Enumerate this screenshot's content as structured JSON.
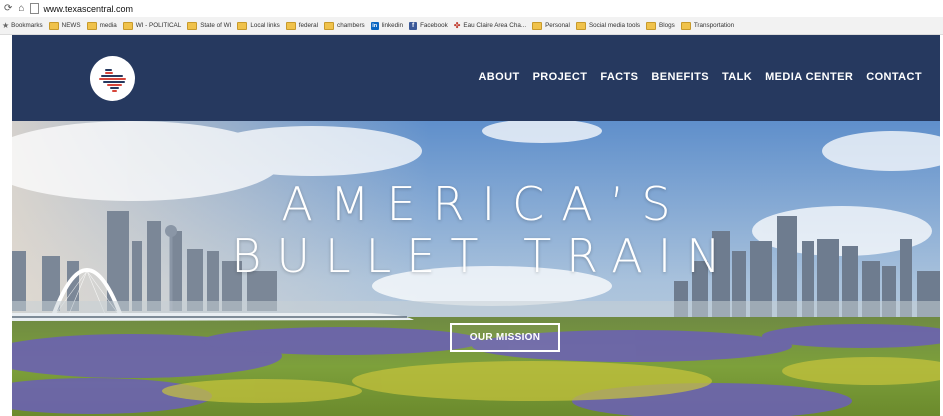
{
  "browser": {
    "url": "www.texascentral.com",
    "bookmarks": [
      {
        "label": "Bookmarks",
        "icon": "star-icon"
      },
      {
        "label": "NEWS",
        "icon": "folder-icon"
      },
      {
        "label": "media",
        "icon": "folder-icon"
      },
      {
        "label": "WI - POLITICAL",
        "icon": "folder-icon"
      },
      {
        "label": "State of WI",
        "icon": "folder-icon"
      },
      {
        "label": "Local links",
        "icon": "folder-icon"
      },
      {
        "label": "federal",
        "icon": "folder-icon"
      },
      {
        "label": "chambers",
        "icon": "folder-icon"
      },
      {
        "label": "linkedin",
        "icon": "linkedin-icon"
      },
      {
        "label": "Facebook",
        "icon": "facebook-icon"
      },
      {
        "label": "Eau Claire Area Cha...",
        "icon": "chamber-icon"
      },
      {
        "label": "Personal",
        "icon": "folder-icon"
      },
      {
        "label": "Social media tools",
        "icon": "folder-icon"
      },
      {
        "label": "Blogs",
        "icon": "folder-icon"
      },
      {
        "label": "Transportation",
        "icon": "folder-icon"
      }
    ]
  },
  "header": {
    "nav": [
      "ABOUT",
      "PROJECT",
      "FACTS",
      "BENEFITS",
      "TALK",
      "MEDIA CENTER",
      "CONTACT"
    ]
  },
  "hero": {
    "headline_line1": "AMERICA’S",
    "headline_line2": "BULLET TRAIN",
    "cta_label": "OUR MISSION"
  },
  "colors": {
    "header_bg": "#26395f",
    "logo_red": "#d6453a",
    "logo_blue": "#26395f"
  }
}
